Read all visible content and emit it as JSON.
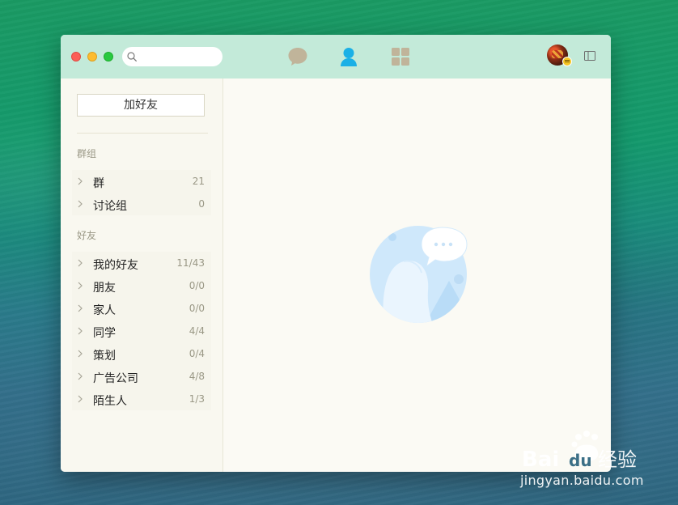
{
  "app": {
    "search": {
      "placeholder": "",
      "value": ""
    },
    "nav_tabs": [
      {
        "name": "messages",
        "icon": "chat-bubble-icon",
        "active": false
      },
      {
        "name": "contacts",
        "icon": "person-icon",
        "active": true
      },
      {
        "name": "apps",
        "icon": "grid-icon",
        "active": false
      }
    ],
    "colors": {
      "titlebar": "#c3ead9",
      "active_tab": "#1ab0e6",
      "inactive_tab": "#c0b49a",
      "sidebar": "#f9f8f0"
    }
  },
  "sidebar": {
    "add_friend_label": "加好友",
    "groups_header": "群组",
    "groups": [
      {
        "label": "群",
        "count": "21"
      },
      {
        "label": "讨论组",
        "count": "0"
      }
    ],
    "friends_header": "好友",
    "friends": [
      {
        "label": "我的好友",
        "count": "11/43"
      },
      {
        "label": "朋友",
        "count": "0/0"
      },
      {
        "label": "家人",
        "count": "0/0"
      },
      {
        "label": "同学",
        "count": "4/4"
      },
      {
        "label": "策划",
        "count": "0/4"
      },
      {
        "label": "广告公司",
        "count": "4/8"
      },
      {
        "label": "陌生人",
        "count": "1/3"
      }
    ]
  },
  "watermark": {
    "brand": "Bai du 经验",
    "url": "jingyan.baidu.com"
  }
}
